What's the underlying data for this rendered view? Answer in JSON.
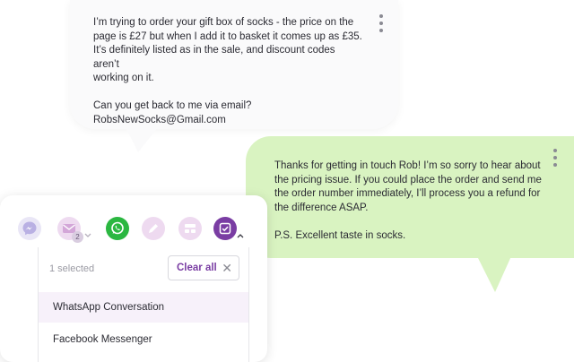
{
  "incoming_message": {
    "text": "I’m trying to order your gift box of socks - the price on the\npage is £27 but when I add it to basket it comes up as £35.\nIt’s definitely listed as in the sale, and discount codes aren’t\nworking on it.\n\nCan you get back to me via email?\nRobsNewSocks@Gmail.com"
  },
  "outgoing_message": {
    "text": "Thanks for getting in touch Rob! I’m so sorry to hear about\nthe pricing issue. If you could place the order and send me\nthe order number immediately, I’ll process you a refund for\nthe difference ASAP.\n\nP.S. Excellent taste in socks."
  },
  "channel_selector": {
    "channels": [
      {
        "icon": "messenger-icon",
        "color": "#d9d4f0"
      },
      {
        "icon": "email-icon",
        "color": "#e4c9e6",
        "badge": "2"
      },
      {
        "icon": "whatsapp-icon",
        "color": "#2bb741"
      },
      {
        "icon": "pencil-icon",
        "color": "#e4c9e6"
      },
      {
        "icon": "layout-icon",
        "color": "#e4c9e6"
      },
      {
        "icon": "checkbox-icon",
        "color": "#7a3da3"
      }
    ],
    "selected_count": "1 selected",
    "clear_label": "Clear all",
    "options": [
      "WhatsApp Conversation",
      "Facebook Messenger"
    ]
  },
  "colors": {
    "accent": "#7a3da3",
    "outgoing_bubble": "#d9f3c1",
    "incoming_bubble": "#fafafb"
  }
}
